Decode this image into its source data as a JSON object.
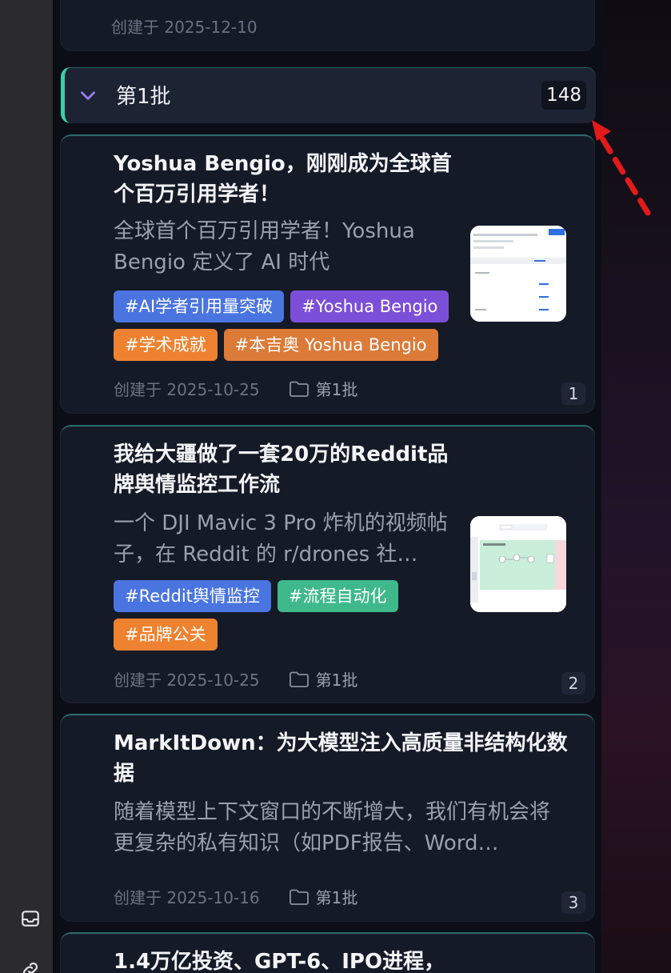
{
  "previous_card": {
    "date_text": "创建于 2025-12-10"
  },
  "group": {
    "title": "第1批",
    "count": "148"
  },
  "cards": [
    {
      "title": "Yoshua Bengio，刚刚成为全球首个百万引用学者！",
      "summary": "全球首个百万引用学者！Yoshua Bengio 定义了 AI 时代",
      "tags": [
        {
          "label": "#AI学者引用量突破",
          "color": "#4a74e0"
        },
        {
          "label": "#Yoshua Bengio",
          "color": "#7c4fd8"
        },
        {
          "label": "#学术成就",
          "color": "#ee8230"
        },
        {
          "label": "#本吉奥 Yoshua Bengio",
          "color": "#dc7a38"
        }
      ],
      "date_text": "创建于 2025-10-25",
      "batch": "第1批",
      "index": "1"
    },
    {
      "title": "我给大疆做了一套20万的Reddit品牌舆情监控工作流",
      "summary": "一个 DJI Mavic 3 Pro 炸机的视频帖子，在 Reddit 的 r/drones 社…",
      "tags": [
        {
          "label": "#Reddit舆情监控",
          "color": "#4a74e0"
        },
        {
          "label": "#流程自动化",
          "color": "#3fb98c"
        },
        {
          "label": "#品牌公关",
          "color": "#ee8230"
        }
      ],
      "date_text": "创建于 2025-10-25",
      "batch": "第1批",
      "index": "2"
    },
    {
      "title": "MarkItDown：为大模型注入高质量非结构化数据",
      "summary": "随着模型上下文窗口的不断增大，我们有机会将更复杂的私有知识（如PDF报告、Word…",
      "tags": [],
      "date_text": "创建于 2025-10-16",
      "batch": "第1批",
      "index": "3"
    },
    {
      "title": "1.4万亿投资、GPT-6、IPO进程，",
      "summary": "",
      "tags": [],
      "date_text": "",
      "batch": "",
      "index": ""
    }
  ],
  "icons": {
    "chevron": "chevron-down-icon",
    "folder": "folder-icon",
    "inbox": "inbox-icon",
    "link": "link-icon",
    "arrow": "annotation-arrow-icon"
  },
  "colors": {
    "accent_teal": "#35d1a4",
    "chevron_purple": "#9b7cf0",
    "arrow_red": "#e11a1a"
  }
}
